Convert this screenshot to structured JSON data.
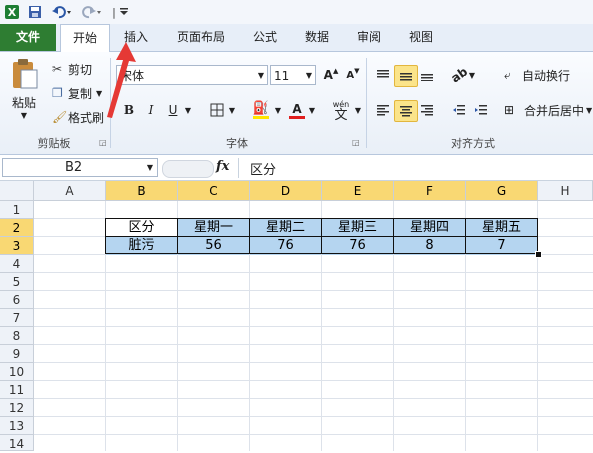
{
  "quick_access": {
    "excel_icon": "excel-icon",
    "save_icon": "save-icon",
    "undo_icon": "undo-icon",
    "redo_icon": "redo-icon",
    "customize_icon": "customize-icon"
  },
  "tabs": [
    {
      "label": "文件"
    },
    {
      "label": "开始"
    },
    {
      "label": "插入"
    },
    {
      "label": "页面布局"
    },
    {
      "label": "公式"
    },
    {
      "label": "数据"
    },
    {
      "label": "审阅"
    },
    {
      "label": "视图"
    }
  ],
  "ribbon": {
    "clipboard": {
      "paste": "粘贴",
      "cut": "剪切",
      "copy": "复制",
      "format_painter": "格式刷",
      "group_label": "剪贴板"
    },
    "font": {
      "font_name": "宋体",
      "font_size": "11",
      "bold": "B",
      "italic": "I",
      "underline": "U",
      "phonetic": "wén",
      "phonetic_char": "文",
      "grow": "A",
      "shrink": "A",
      "font_color_letter": "A",
      "group_label": "字体"
    },
    "alignment": {
      "wrap_text": "自动换行",
      "merge_center": "合并后居中",
      "group_label": "对齐方式"
    }
  },
  "formula_bar": {
    "name_box": "B2",
    "fx": "fx",
    "content": "区分"
  },
  "columns": [
    "A",
    "B",
    "C",
    "D",
    "E",
    "F",
    "G",
    "H"
  ],
  "rows": [
    "1",
    "2",
    "3",
    "4",
    "5",
    "6",
    "7",
    "8",
    "9",
    "10",
    "11",
    "12",
    "13",
    "14"
  ],
  "table": {
    "header": [
      "区分",
      "星期一",
      "星期二",
      "星期三",
      "星期四",
      "星期五"
    ],
    "row": [
      "脏污",
      "56",
      "76",
      "76",
      "8",
      "7"
    ]
  },
  "colors": {
    "file_tab": "#2e7d32",
    "selected_header": "#f9d873",
    "selection_fill": "#b5d5f0",
    "annotation_arrow": "#e53935"
  }
}
